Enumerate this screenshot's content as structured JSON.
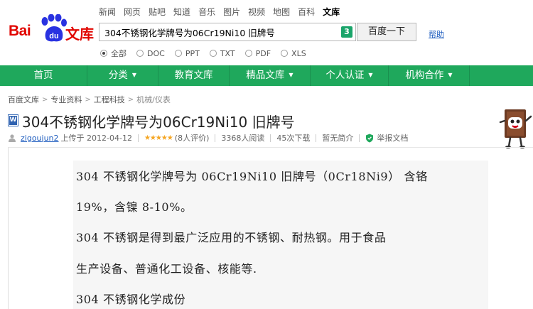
{
  "header": {
    "top_nav": [
      "新闻",
      "网页",
      "贴吧",
      "知道",
      "音乐",
      "图片",
      "视频",
      "地图",
      "百科",
      "文库"
    ],
    "logo_text_bai": "Bai",
    "logo_text_du": "du",
    "logo_text_wenku": "文库",
    "search_value": "304不锈钢化学牌号为06Cr19Ni10 旧牌号",
    "clear_badge": "3",
    "search_button": "百度一下",
    "help_link": "帮助",
    "filters": [
      "全部",
      "DOC",
      "PPT",
      "TXT",
      "PDF",
      "XLS"
    ]
  },
  "nav": {
    "items": [
      {
        "label": "首页",
        "caret": ""
      },
      {
        "label": "分类",
        "caret": "▼"
      },
      {
        "label": "教育文库",
        "caret": ""
      },
      {
        "label": "精品文库",
        "caret": "▼"
      },
      {
        "label": "个人认证",
        "caret": "▼"
      },
      {
        "label": "机构合作",
        "caret": "▼"
      }
    ]
  },
  "breadcrumb": [
    "百度文库",
    "专业资料",
    "工程科技",
    "机械/仪表"
  ],
  "breadcrumb_sep": ">",
  "document": {
    "icon_letter": "W",
    "title": "304不锈钢化学牌号为06Cr19Ni10 旧牌号",
    "user": "zigoujun2",
    "uploaded": "上传于 2012-04-12",
    "stars": "★★★★★",
    "score": "(8人评价)",
    "reads": "3368人阅读",
    "downloads": "45次下载",
    "summary": "暂无简介",
    "report": "举报文档"
  },
  "content": {
    "lines": [
      "304 不锈钢化学牌号为 06Cr19Ni10  旧牌号（0Cr18Ni9）  含铬",
      "19%，含镍 8-10%。",
      "   304 不锈钢是得到最广泛应用的不锈钢、耐热钢。用于食品",
      "生产设备、普通化工设备、核能等.",
      "   304 不锈钢化学成份"
    ]
  },
  "colors": {
    "brand_red": "#e10601",
    "paw_blue": "#2932e1",
    "nav_green": "#1fa85c",
    "star": "#f5a623",
    "link_blue": "#1d5cbf"
  }
}
